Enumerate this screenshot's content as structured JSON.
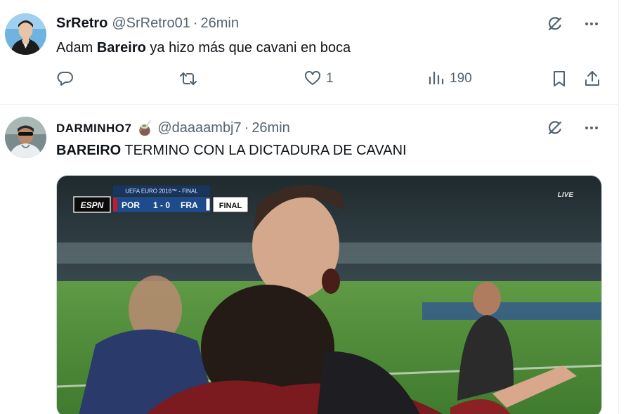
{
  "tweets": [
    {
      "display_name": "SrRetro",
      "handle": "@SrRetro01",
      "separator": "·",
      "time": "26min",
      "text_before": "Adam ",
      "text_bold": "Bareiro",
      "text_after": " ya hizo más que cavani en boca",
      "actions": {
        "reply_count": "",
        "retweet_count": "",
        "like_count": "1",
        "views_count": "190"
      }
    },
    {
      "display_name": "DARMINHO7",
      "display_emoji": "🧉",
      "handle": "@daaaambj7",
      "separator": "·",
      "time": "26min",
      "text_bold": "BAREIRO",
      "text_after": " TERMINO CON LA DICTADURA DE CAVANI",
      "media": {
        "scoreboard": {
          "competition": "UEFA EURO 2016™ - FINAL",
          "network": "ESPN",
          "team_home": "POR",
          "score": "1 - 0",
          "team_away": "FRA",
          "status": "FINAL"
        },
        "live_badge": "LIVE"
      }
    }
  ],
  "icons": {
    "grok": "grok-icon",
    "more": "more-icon",
    "reply": "reply-icon",
    "retweet": "retweet-icon",
    "like": "heart-icon",
    "views": "views-icon",
    "bookmark": "bookmark-icon",
    "share": "share-icon"
  },
  "colors": {
    "text_primary": "#0f1419",
    "text_secondary": "#536471",
    "divider": "#eff3f4"
  }
}
